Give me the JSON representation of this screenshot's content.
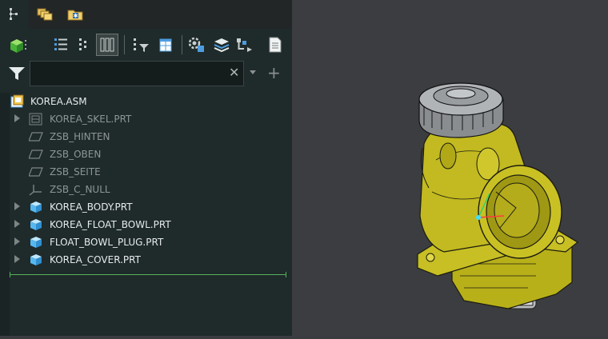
{
  "tree": {
    "root": "KOREA.ASM",
    "items": [
      {
        "label": "KOREA_SKEL.PRT",
        "expandable": true,
        "style": "dim",
        "icon": "skeleton-part-icon"
      },
      {
        "label": "ZSB_HINTEN",
        "expandable": false,
        "style": "dim",
        "icon": "datum-plane-icon"
      },
      {
        "label": "ZSB_OBEN",
        "expandable": false,
        "style": "dim",
        "icon": "datum-plane-icon"
      },
      {
        "label": "ZSB_SEITE",
        "expandable": false,
        "style": "dim",
        "icon": "datum-plane-icon"
      },
      {
        "label": "ZSB_C_NULL",
        "expandable": false,
        "style": "dim",
        "icon": "coordinate-system-icon"
      },
      {
        "label": "KOREA_BODY.PRT",
        "expandable": true,
        "style": "bright",
        "icon": "part-icon"
      },
      {
        "label": "KOREA_FLOAT_BOWL.PRT",
        "expandable": true,
        "style": "bright",
        "icon": "part-icon"
      },
      {
        "label": "FLOAT_BOWL_PLUG.PRT",
        "expandable": true,
        "style": "bright",
        "icon": "part-icon"
      },
      {
        "label": "KOREA_COVER.PRT",
        "expandable": true,
        "style": "bright",
        "icon": "part-icon"
      }
    ]
  },
  "filter": {
    "value": "",
    "clear_glyph": "✕"
  },
  "colors": {
    "panel": "#1f2a2a",
    "viewport": "#3b3d40",
    "model": "#c8c21e",
    "cap": "#8a8d90",
    "insert_line": "#53b25a"
  }
}
